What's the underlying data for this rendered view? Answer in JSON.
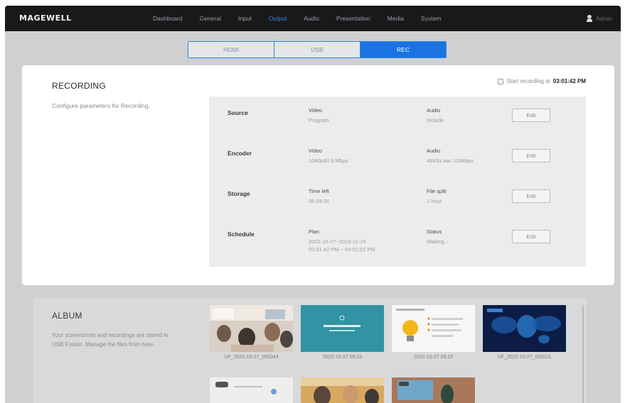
{
  "brand": {
    "logo_text": "MAGEWELL",
    "accent": "#1a73e1",
    "topbar_bg": "#18191b"
  },
  "nav": {
    "items": [
      {
        "label": "Dashboard",
        "active": false
      },
      {
        "label": "General",
        "active": false
      },
      {
        "label": "Input",
        "active": false
      },
      {
        "label": "Output",
        "active": true
      },
      {
        "label": "Audio",
        "active": false
      },
      {
        "label": "Presentation",
        "active": false
      },
      {
        "label": "Media",
        "active": false
      },
      {
        "label": "System",
        "active": false
      }
    ],
    "user": {
      "icon": "user-icon",
      "name": "Admin"
    }
  },
  "subtabs": [
    {
      "label": "HDMI",
      "active": false
    },
    {
      "label": "USB",
      "active": false
    },
    {
      "label": "REC",
      "active": true
    }
  ],
  "recording": {
    "title": "RECORDING",
    "description": "Configure parameters for Recording.",
    "start_label": "Start recording at",
    "start_time": "03:01:42 PM",
    "rows": [
      {
        "label": "Source",
        "a_key": "Video",
        "a_val": "Program",
        "b_key": "Audio",
        "b_val": "Include",
        "edit": "Edit"
      },
      {
        "label": "Encoder",
        "a_key": "Video",
        "a_val": "1080p60 8 Mbps",
        "b_key": "Audio",
        "b_val": "48Khz aac 128kbps",
        "edit": "Edit"
      },
      {
        "label": "Storage",
        "a_key": "Time left",
        "a_val": "06:39:26",
        "b_key": "File split",
        "b_val": "1 hour",
        "edit": "Edit"
      },
      {
        "label": "Schedule",
        "a_key": "Plan",
        "a_val": "2022-10-27~2023-11-15\n03:01:42 PM ~ 04:01:52 PM",
        "b_key": "Status",
        "b_val": "Waiting...",
        "edit": "Edit"
      }
    ]
  },
  "album": {
    "title": "ALBUM",
    "description": "Your screenshots and recordings are stored in USB Fusion. Manage the files from here.",
    "items": [
      {
        "label": "UF_2022-10-27_093344"
      },
      {
        "label": "2022-10-27 09:23"
      },
      {
        "label": "2022-10-27 09:15"
      },
      {
        "label": "UF_2022-10-27_092011"
      }
    ]
  }
}
